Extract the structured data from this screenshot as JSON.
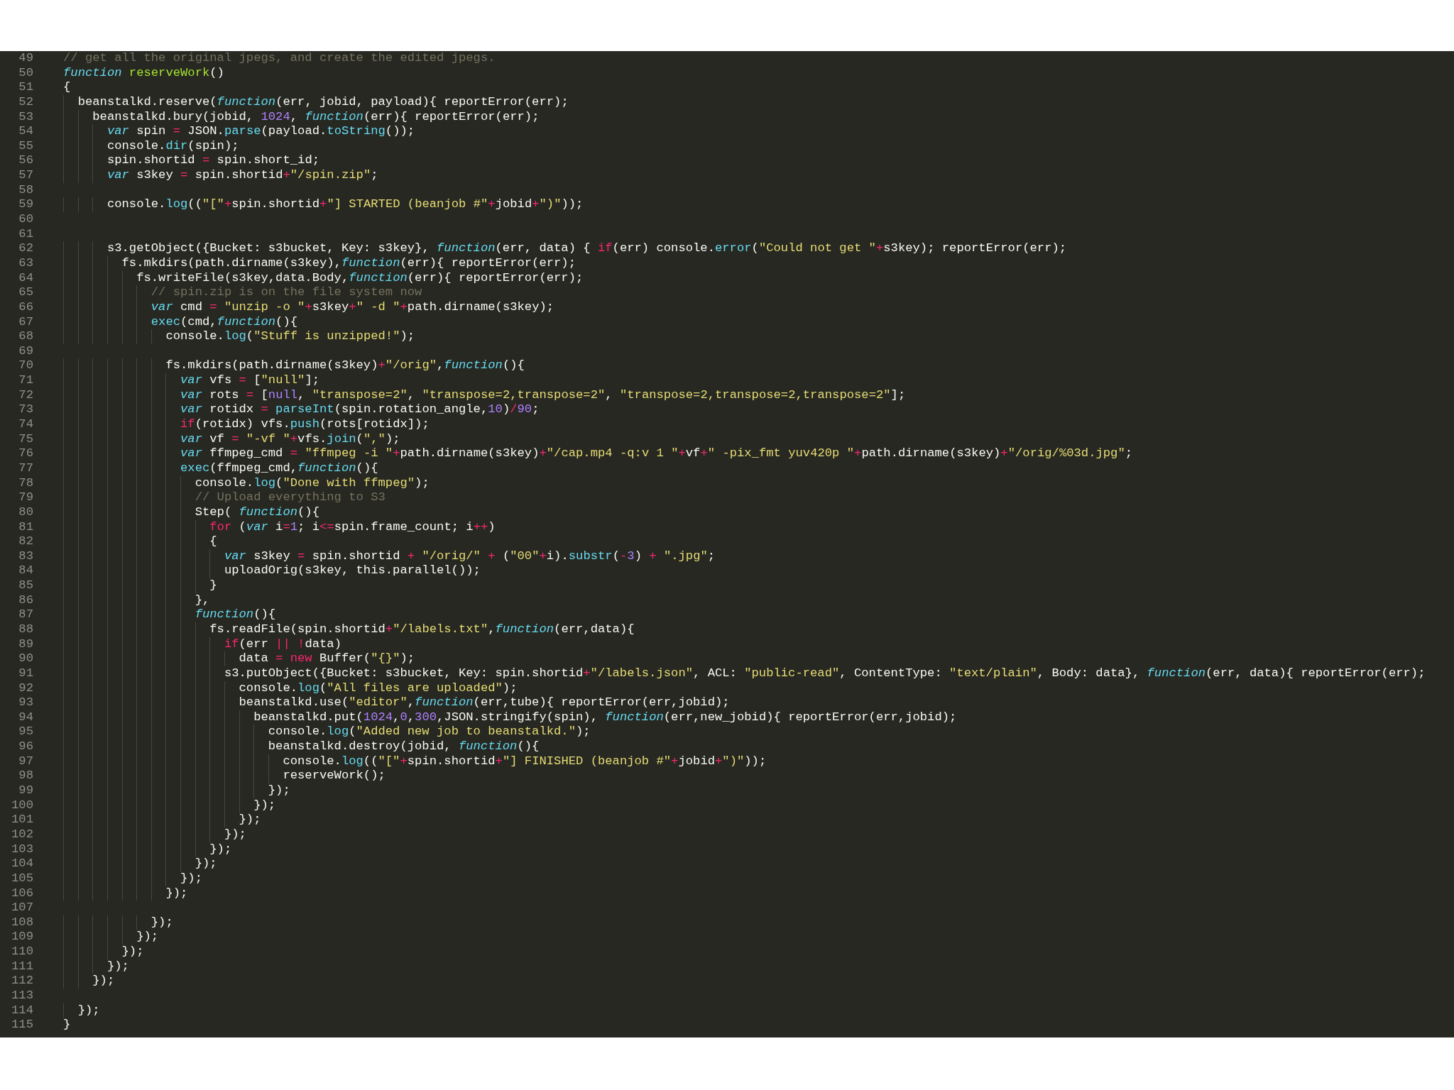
{
  "editor": {
    "lines": [
      {
        "number": "49",
        "tokens": [
          {
            "kind": "comment",
            "text": "// get all the original jpegs, and create the edited jpegs."
          }
        ]
      },
      {
        "number": "50",
        "tokens": [
          {
            "kind": "keyword",
            "text": "function"
          },
          {
            "kind": "function-name",
            "text": " reserveWork"
          },
          {
            "kind": "plain",
            "text": "()"
          }
        ]
      },
      {
        "number": "51",
        "tokens": [
          {
            "kind": "plain",
            "text": "{"
          }
        ]
      },
      {
        "number": "52",
        "tokens": [
          {
            "kind": "plain",
            "text": "  beanstalkd.reserve("
          },
          {
            "kind": "keyword",
            "text": "function"
          },
          {
            "kind": "plain",
            "text": "(err, jobid, payload){ reportError(err);"
          }
        ]
      },
      {
        "number": "53",
        "tokens": [
          {
            "kind": "plain",
            "text": "    beanstalkd.bury(jobid, "
          },
          {
            "kind": "number",
            "text": "1024"
          },
          {
            "kind": "plain",
            "text": ", "
          },
          {
            "kind": "keyword",
            "text": "function"
          },
          {
            "kind": "plain",
            "text": "(err){ reportError(err);"
          }
        ]
      },
      {
        "number": "54",
        "tokens": [
          {
            "kind": "keyword",
            "text": "      var"
          },
          {
            "kind": "plain",
            "text": " spin "
          },
          {
            "kind": "operator",
            "text": "="
          },
          {
            "kind": "plain",
            "text": " JSON."
          },
          {
            "kind": "builtin",
            "text": "parse"
          },
          {
            "kind": "plain",
            "text": "(payload."
          },
          {
            "kind": "builtin",
            "text": "toString"
          },
          {
            "kind": "plain",
            "text": "());"
          }
        ]
      },
      {
        "number": "55",
        "tokens": [
          {
            "kind": "plain",
            "text": "      console."
          },
          {
            "kind": "builtin",
            "text": "dir"
          },
          {
            "kind": "plain",
            "text": "(spin);"
          }
        ]
      },
      {
        "number": "56",
        "tokens": [
          {
            "kind": "plain",
            "text": "      spin.shortid "
          },
          {
            "kind": "operator",
            "text": "="
          },
          {
            "kind": "plain",
            "text": " spin.short_id;"
          }
        ]
      },
      {
        "number": "57",
        "tokens": [
          {
            "kind": "keyword",
            "text": "      var"
          },
          {
            "kind": "plain",
            "text": " s3key "
          },
          {
            "kind": "operator",
            "text": "="
          },
          {
            "kind": "plain",
            "text": " spin.shortid"
          },
          {
            "kind": "operator",
            "text": "+"
          },
          {
            "kind": "string",
            "text": "\"/spin.zip\""
          },
          {
            "kind": "plain",
            "text": ";"
          }
        ]
      },
      {
        "number": "58"
      },
      {
        "number": "59",
        "tokens": [
          {
            "kind": "plain",
            "text": "      console."
          },
          {
            "kind": "builtin",
            "text": "log"
          },
          {
            "kind": "plain",
            "text": "(("
          },
          {
            "kind": "string",
            "text": "\"[\""
          },
          {
            "kind": "operator",
            "text": "+"
          },
          {
            "kind": "plain",
            "text": "spin.shortid"
          },
          {
            "kind": "operator",
            "text": "+"
          },
          {
            "kind": "string",
            "text": "\"] STARTED (beanjob #\""
          },
          {
            "kind": "operator",
            "text": "+"
          },
          {
            "kind": "plain",
            "text": "jobid"
          },
          {
            "kind": "operator",
            "text": "+"
          },
          {
            "kind": "string",
            "text": "\")\""
          },
          {
            "kind": "plain",
            "text": "));"
          }
        ]
      },
      {
        "number": "60"
      },
      {
        "number": "61"
      },
      {
        "number": "62",
        "tokens": [
          {
            "kind": "plain",
            "text": "      s3.getObject({Bucket: s3bucket, Key: s3key}, "
          },
          {
            "kind": "keyword",
            "text": "function"
          },
          {
            "kind": "plain",
            "text": "(err, data) { "
          },
          {
            "kind": "control",
            "text": "if"
          },
          {
            "kind": "plain",
            "text": "(err) console."
          },
          {
            "kind": "builtin",
            "text": "error"
          },
          {
            "kind": "plain",
            "text": "("
          },
          {
            "kind": "string",
            "text": "\"Could not get \""
          },
          {
            "kind": "operator",
            "text": "+"
          },
          {
            "kind": "plain",
            "text": "s3key); reportError(err);"
          }
        ]
      },
      {
        "number": "63",
        "tokens": [
          {
            "kind": "plain",
            "text": "        fs.mkdirs(path.dirname(s3key),"
          },
          {
            "kind": "keyword",
            "text": "function"
          },
          {
            "kind": "plain",
            "text": "(err){ reportError(err);"
          }
        ]
      },
      {
        "number": "64",
        "tokens": [
          {
            "kind": "plain",
            "text": "          fs.writeFile(s3key,data.Body,"
          },
          {
            "kind": "keyword",
            "text": "function"
          },
          {
            "kind": "plain",
            "text": "(err){ reportError(err);"
          }
        ]
      },
      {
        "number": "65",
        "tokens": [
          {
            "kind": "comment",
            "text": "            // spin.zip is on the file system now"
          }
        ]
      },
      {
        "number": "66",
        "tokens": [
          {
            "kind": "keyword",
            "text": "            var"
          },
          {
            "kind": "plain",
            "text": " cmd "
          },
          {
            "kind": "operator",
            "text": "="
          },
          {
            "kind": "string",
            "text": " \"unzip -o \""
          },
          {
            "kind": "operator",
            "text": "+"
          },
          {
            "kind": "plain",
            "text": "s3key"
          },
          {
            "kind": "operator",
            "text": "+"
          },
          {
            "kind": "string",
            "text": "\" -d \""
          },
          {
            "kind": "operator",
            "text": "+"
          },
          {
            "kind": "plain",
            "text": "path.dirname(s3key);"
          }
        ]
      },
      {
        "number": "67",
        "tokens": [
          {
            "kind": "builtin",
            "text": "            exec"
          },
          {
            "kind": "plain",
            "text": "(cmd,"
          },
          {
            "kind": "keyword",
            "text": "function"
          },
          {
            "kind": "plain",
            "text": "(){"
          }
        ]
      },
      {
        "number": "68",
        "tokens": [
          {
            "kind": "plain",
            "text": "              console."
          },
          {
            "kind": "builtin",
            "text": "log"
          },
          {
            "kind": "plain",
            "text": "("
          },
          {
            "kind": "string",
            "text": "\"Stuff is unzipped!\""
          },
          {
            "kind": "plain",
            "text": ");"
          }
        ]
      },
      {
        "number": "69"
      },
      {
        "number": "70",
        "tokens": [
          {
            "kind": "plain",
            "text": "              fs.mkdirs(path.dirname(s3key)"
          },
          {
            "kind": "operator",
            "text": "+"
          },
          {
            "kind": "string",
            "text": "\"/orig\""
          },
          {
            "kind": "plain",
            "text": ","
          },
          {
            "kind": "keyword",
            "text": "function"
          },
          {
            "kind": "plain",
            "text": "(){"
          }
        ]
      },
      {
        "number": "71",
        "tokens": [
          {
            "kind": "keyword",
            "text": "                var"
          },
          {
            "kind": "plain",
            "text": " vfs "
          },
          {
            "kind": "operator",
            "text": "="
          },
          {
            "kind": "plain",
            "text": " ["
          },
          {
            "kind": "string",
            "text": "\"null\""
          },
          {
            "kind": "plain",
            "text": "];"
          }
        ]
      },
      {
        "number": "72",
        "tokens": [
          {
            "kind": "keyword",
            "text": "                var"
          },
          {
            "kind": "plain",
            "text": " rots "
          },
          {
            "kind": "operator",
            "text": "="
          },
          {
            "kind": "plain",
            "text": " ["
          },
          {
            "kind": "number",
            "text": "null"
          },
          {
            "kind": "plain",
            "text": ", "
          },
          {
            "kind": "string",
            "text": "\"transpose=2\""
          },
          {
            "kind": "plain",
            "text": ", "
          },
          {
            "kind": "string",
            "text": "\"transpose=2,transpose=2\""
          },
          {
            "kind": "plain",
            "text": ", "
          },
          {
            "kind": "string",
            "text": "\"transpose=2,transpose=2,transpose=2\""
          },
          {
            "kind": "plain",
            "text": "];"
          }
        ]
      },
      {
        "number": "73",
        "tokens": [
          {
            "kind": "keyword",
            "text": "                var"
          },
          {
            "kind": "plain",
            "text": " rotidx "
          },
          {
            "kind": "operator",
            "text": "="
          },
          {
            "kind": "builtin",
            "text": " parseInt"
          },
          {
            "kind": "plain",
            "text": "(spin.rotation_angle,"
          },
          {
            "kind": "number",
            "text": "10"
          },
          {
            "kind": "plain",
            "text": ")"
          },
          {
            "kind": "operator",
            "text": "/"
          },
          {
            "kind": "number",
            "text": "90"
          },
          {
            "kind": "plain",
            "text": ";"
          }
        ]
      },
      {
        "number": "74",
        "tokens": [
          {
            "kind": "control",
            "text": "                if"
          },
          {
            "kind": "plain",
            "text": "(rotidx) vfs."
          },
          {
            "kind": "builtin",
            "text": "push"
          },
          {
            "kind": "plain",
            "text": "(rots[rotidx]);"
          }
        ]
      },
      {
        "number": "75",
        "tokens": [
          {
            "kind": "keyword",
            "text": "                var"
          },
          {
            "kind": "plain",
            "text": " vf "
          },
          {
            "kind": "operator",
            "text": "="
          },
          {
            "kind": "string",
            "text": " \"-vf \""
          },
          {
            "kind": "operator",
            "text": "+"
          },
          {
            "kind": "plain",
            "text": "vfs."
          },
          {
            "kind": "builtin",
            "text": "join"
          },
          {
            "kind": "plain",
            "text": "("
          },
          {
            "kind": "string",
            "text": "\",\""
          },
          {
            "kind": "plain",
            "text": ");"
          }
        ]
      },
      {
        "number": "76",
        "tokens": [
          {
            "kind": "keyword",
            "text": "                var"
          },
          {
            "kind": "plain",
            "text": " ffmpeg_cmd "
          },
          {
            "kind": "operator",
            "text": "="
          },
          {
            "kind": "string",
            "text": " \"ffmpeg -i \""
          },
          {
            "kind": "operator",
            "text": "+"
          },
          {
            "kind": "plain",
            "text": "path.dirname(s3key)"
          },
          {
            "kind": "operator",
            "text": "+"
          },
          {
            "kind": "string",
            "text": "\"/cap.mp4 -q:v 1 \""
          },
          {
            "kind": "operator",
            "text": "+"
          },
          {
            "kind": "plain",
            "text": "vf"
          },
          {
            "kind": "operator",
            "text": "+"
          },
          {
            "kind": "string",
            "text": "\" -pix_fmt yuv420p \""
          },
          {
            "kind": "operator",
            "text": "+"
          },
          {
            "kind": "plain",
            "text": "path.dirname(s3key)"
          },
          {
            "kind": "operator",
            "text": "+"
          },
          {
            "kind": "string",
            "text": "\"/orig/%03d.jpg\""
          },
          {
            "kind": "plain",
            "text": ";"
          }
        ]
      },
      {
        "number": "77",
        "tokens": [
          {
            "kind": "builtin",
            "text": "                exec"
          },
          {
            "kind": "plain",
            "text": "(ffmpeg_cmd,"
          },
          {
            "kind": "keyword",
            "text": "function"
          },
          {
            "kind": "plain",
            "text": "(){"
          }
        ]
      },
      {
        "number": "78",
        "tokens": [
          {
            "kind": "plain",
            "text": "                  console."
          },
          {
            "kind": "builtin",
            "text": "log"
          },
          {
            "kind": "plain",
            "text": "("
          },
          {
            "kind": "string",
            "text": "\"Done with ffmpeg\""
          },
          {
            "kind": "plain",
            "text": ");"
          }
        ]
      },
      {
        "number": "79",
        "tokens": [
          {
            "kind": "comment",
            "text": "                  // Upload everything to S3"
          }
        ]
      },
      {
        "number": "80",
        "tokens": [
          {
            "kind": "plain",
            "text": "                  Step( "
          },
          {
            "kind": "keyword",
            "text": "function"
          },
          {
            "kind": "plain",
            "text": "(){"
          }
        ]
      },
      {
        "number": "81",
        "tokens": [
          {
            "kind": "control",
            "text": "                    for"
          },
          {
            "kind": "plain",
            "text": " ("
          },
          {
            "kind": "keyword",
            "text": "var"
          },
          {
            "kind": "plain",
            "text": " i"
          },
          {
            "kind": "operator",
            "text": "="
          },
          {
            "kind": "number",
            "text": "1"
          },
          {
            "kind": "plain",
            "text": "; i"
          },
          {
            "kind": "operator",
            "text": "<="
          },
          {
            "kind": "plain",
            "text": "spin.frame_count; i"
          },
          {
            "kind": "operator",
            "text": "++"
          },
          {
            "kind": "plain",
            "text": ")"
          }
        ]
      },
      {
        "number": "82",
        "tokens": [
          {
            "kind": "plain",
            "text": "                    {"
          }
        ]
      },
      {
        "number": "83",
        "tokens": [
          {
            "kind": "keyword",
            "text": "                      var"
          },
          {
            "kind": "plain",
            "text": " s3key "
          },
          {
            "kind": "operator",
            "text": "="
          },
          {
            "kind": "plain",
            "text": " spin.shortid "
          },
          {
            "kind": "operator",
            "text": "+"
          },
          {
            "kind": "string",
            "text": " \"/orig/\""
          },
          {
            "kind": "operator",
            "text": " +"
          },
          {
            "kind": "plain",
            "text": " ("
          },
          {
            "kind": "string",
            "text": "\"00\""
          },
          {
            "kind": "operator",
            "text": "+"
          },
          {
            "kind": "plain",
            "text": "i)."
          },
          {
            "kind": "builtin",
            "text": "substr"
          },
          {
            "kind": "plain",
            "text": "("
          },
          {
            "kind": "operator",
            "text": "-"
          },
          {
            "kind": "number",
            "text": "3"
          },
          {
            "kind": "plain",
            "text": ") "
          },
          {
            "kind": "operator",
            "text": "+"
          },
          {
            "kind": "string",
            "text": " \".jpg\""
          },
          {
            "kind": "plain",
            "text": ";"
          }
        ]
      },
      {
        "number": "84",
        "tokens": [
          {
            "kind": "plain",
            "text": "                      uploadOrig(s3key, this.parallel());"
          }
        ]
      },
      {
        "number": "85",
        "tokens": [
          {
            "kind": "plain",
            "text": "                    }"
          }
        ]
      },
      {
        "number": "86",
        "tokens": [
          {
            "kind": "plain",
            "text": "                  },"
          }
        ]
      },
      {
        "number": "87",
        "tokens": [
          {
            "kind": "keyword",
            "text": "                  function"
          },
          {
            "kind": "plain",
            "text": "(){"
          }
        ]
      },
      {
        "number": "88",
        "tokens": [
          {
            "kind": "plain",
            "text": "                    fs.readFile(spin.shortid"
          },
          {
            "kind": "operator",
            "text": "+"
          },
          {
            "kind": "string",
            "text": "\"/labels.txt\""
          },
          {
            "kind": "plain",
            "text": ","
          },
          {
            "kind": "keyword",
            "text": "function"
          },
          {
            "kind": "plain",
            "text": "(err,data){"
          }
        ]
      },
      {
        "number": "89",
        "tokens": [
          {
            "kind": "control",
            "text": "                      if"
          },
          {
            "kind": "plain",
            "text": "(err "
          },
          {
            "kind": "operator",
            "text": "||"
          },
          {
            "kind": "operator",
            "text": " !"
          },
          {
            "kind": "plain",
            "text": "data)"
          }
        ]
      },
      {
        "number": "90",
        "tokens": [
          {
            "kind": "plain",
            "text": "                        data "
          },
          {
            "kind": "operator",
            "text": "="
          },
          {
            "kind": "control",
            "text": " new"
          },
          {
            "kind": "plain",
            "text": " Buffer("
          },
          {
            "kind": "string",
            "text": "\"{}\""
          },
          {
            "kind": "plain",
            "text": ");"
          }
        ]
      },
      {
        "number": "91",
        "tokens": [
          {
            "kind": "plain",
            "text": "                      s3.putObject({Bucket: s3bucket, Key: spin.shortid"
          },
          {
            "kind": "operator",
            "text": "+"
          },
          {
            "kind": "string",
            "text": "\"/labels.json\""
          },
          {
            "kind": "plain",
            "text": ", ACL: "
          },
          {
            "kind": "string",
            "text": "\"public-read\""
          },
          {
            "kind": "plain",
            "text": ", ContentType: "
          },
          {
            "kind": "string",
            "text": "\"text/plain\""
          },
          {
            "kind": "plain",
            "text": ", Body: data}, "
          },
          {
            "kind": "keyword",
            "text": "function"
          },
          {
            "kind": "plain",
            "text": "(err, data){ reportError(err);"
          }
        ]
      },
      {
        "number": "92",
        "tokens": [
          {
            "kind": "plain",
            "text": "                        console."
          },
          {
            "kind": "builtin",
            "text": "log"
          },
          {
            "kind": "plain",
            "text": "("
          },
          {
            "kind": "string",
            "text": "\"All files are uploaded\""
          },
          {
            "kind": "plain",
            "text": ");"
          }
        ]
      },
      {
        "number": "93",
        "tokens": [
          {
            "kind": "plain",
            "text": "                        beanstalkd.use("
          },
          {
            "kind": "string",
            "text": "\"editor\""
          },
          {
            "kind": "plain",
            "text": ","
          },
          {
            "kind": "keyword",
            "text": "function"
          },
          {
            "kind": "plain",
            "text": "(err,tube){ reportError(err,jobid);"
          }
        ]
      },
      {
        "number": "94",
        "tokens": [
          {
            "kind": "plain",
            "text": "                          beanstalkd.put("
          },
          {
            "kind": "number",
            "text": "1024"
          },
          {
            "kind": "plain",
            "text": ","
          },
          {
            "kind": "number",
            "text": "0"
          },
          {
            "kind": "plain",
            "text": ","
          },
          {
            "kind": "number",
            "text": "300"
          },
          {
            "kind": "plain",
            "text": ",JSON.stringify(spin), "
          },
          {
            "kind": "keyword",
            "text": "function"
          },
          {
            "kind": "plain",
            "text": "(err,new_jobid){ reportError(err,jobid);"
          }
        ]
      },
      {
        "number": "95",
        "tokens": [
          {
            "kind": "plain",
            "text": "                            console."
          },
          {
            "kind": "builtin",
            "text": "log"
          },
          {
            "kind": "plain",
            "text": "("
          },
          {
            "kind": "string",
            "text": "\"Added new job to beanstalkd.\""
          },
          {
            "kind": "plain",
            "text": ");"
          }
        ]
      },
      {
        "number": "96",
        "tokens": [
          {
            "kind": "plain",
            "text": "                            beanstalkd.destroy(jobid, "
          },
          {
            "kind": "keyword",
            "text": "function"
          },
          {
            "kind": "plain",
            "text": "(){"
          }
        ]
      },
      {
        "number": "97",
        "tokens": [
          {
            "kind": "plain",
            "text": "                              console."
          },
          {
            "kind": "builtin",
            "text": "log"
          },
          {
            "kind": "plain",
            "text": "(("
          },
          {
            "kind": "string",
            "text": "\"[\""
          },
          {
            "kind": "operator",
            "text": "+"
          },
          {
            "kind": "plain",
            "text": "spin.shortid"
          },
          {
            "kind": "operator",
            "text": "+"
          },
          {
            "kind": "string",
            "text": "\"] FINISHED (beanjob #\""
          },
          {
            "kind": "operator",
            "text": "+"
          },
          {
            "kind": "plain",
            "text": "jobid"
          },
          {
            "kind": "operator",
            "text": "+"
          },
          {
            "kind": "string",
            "text": "\")\""
          },
          {
            "kind": "plain",
            "text": "));"
          }
        ]
      },
      {
        "number": "98",
        "tokens": [
          {
            "kind": "plain",
            "text": "                              reserveWork();"
          }
        ]
      },
      {
        "number": "99",
        "tokens": [
          {
            "kind": "plain",
            "text": "                            });"
          }
        ]
      },
      {
        "number": "100",
        "tokens": [
          {
            "kind": "plain",
            "text": "                          });"
          }
        ]
      },
      {
        "number": "101",
        "tokens": [
          {
            "kind": "plain",
            "text": "                        });"
          }
        ]
      },
      {
        "number": "102",
        "tokens": [
          {
            "kind": "plain",
            "text": "                      });"
          }
        ]
      },
      {
        "number": "103",
        "tokens": [
          {
            "kind": "plain",
            "text": "                    });"
          }
        ]
      },
      {
        "number": "104",
        "tokens": [
          {
            "kind": "plain",
            "text": "                  });"
          }
        ]
      },
      {
        "number": "105",
        "tokens": [
          {
            "kind": "plain",
            "text": "                });"
          }
        ]
      },
      {
        "number": "106",
        "tokens": [
          {
            "kind": "plain",
            "text": "              });"
          }
        ]
      },
      {
        "number": "107"
      },
      {
        "number": "108",
        "tokens": [
          {
            "kind": "plain",
            "text": "            });"
          }
        ]
      },
      {
        "number": "109",
        "tokens": [
          {
            "kind": "plain",
            "text": "          });"
          }
        ]
      },
      {
        "number": "110",
        "tokens": [
          {
            "kind": "plain",
            "text": "        });"
          }
        ]
      },
      {
        "number": "111",
        "tokens": [
          {
            "kind": "plain",
            "text": "      });"
          }
        ]
      },
      {
        "number": "112",
        "tokens": [
          {
            "kind": "plain",
            "text": "    });"
          }
        ]
      },
      {
        "number": "113"
      },
      {
        "number": "114",
        "tokens": [
          {
            "kind": "plain",
            "text": "  });"
          }
        ]
      },
      {
        "number": "115",
        "tokens": [
          {
            "kind": "plain",
            "text": "}"
          }
        ]
      }
    ]
  }
}
